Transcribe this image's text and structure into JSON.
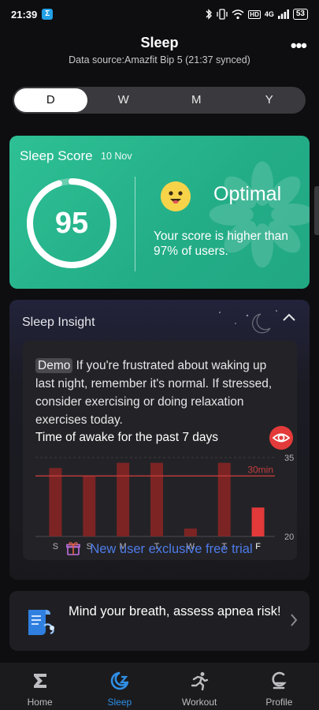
{
  "status_bar": {
    "time": "21:39",
    "app_badge": "Σ",
    "network": "4G",
    "hd": "HD",
    "battery": "53"
  },
  "header": {
    "title": "Sleep",
    "subtitle": "Data source:Amazfit Bip 5 (21:37 synced)",
    "more": "•••"
  },
  "period_tabs": [
    {
      "label": "D",
      "active": true
    },
    {
      "label": "W",
      "active": false
    },
    {
      "label": "M",
      "active": false
    },
    {
      "label": "Y",
      "active": false
    }
  ],
  "score_card": {
    "title": "Sleep Score",
    "date": "10 Nov",
    "score": "95",
    "score_fraction": 0.95,
    "status": "Optimal",
    "description": "Your score is higher than 97% of users.",
    "color": "#2bbb91"
  },
  "insight": {
    "title": "Sleep Insight",
    "demo_label": "Demo",
    "text": "If you're frustrated about waking up last night, remember it's normal. If stressed, consider exercising or doing relaxation exercises today.",
    "chart_title": "Time of awake for the past 7 days",
    "trial_text": "New user exclusive free trial"
  },
  "chart_data": {
    "type": "bar",
    "categories": [
      "S",
      "S",
      "M",
      "T",
      "W",
      "T",
      "F"
    ],
    "values": [
      33,
      31.5,
      34,
      34,
      21.5,
      34,
      25.5
    ],
    "highlight_index": 6,
    "reference_line": {
      "value": 31.5,
      "label": "30min"
    },
    "y_ticks": [
      "35",
      "20"
    ],
    "ylim": [
      20,
      35
    ],
    "colors": {
      "bar": "#7c2424",
      "highlight": "#e23a3a",
      "line": "#c43c3c"
    }
  },
  "apnea_card": {
    "text": "Mind your breath, assess apnea risk!",
    "chevron": "›"
  },
  "bottom_nav": [
    {
      "label": "Home",
      "icon": "sigma-icon",
      "active": false
    },
    {
      "label": "Sleep",
      "icon": "sleep-moon-icon",
      "active": true
    },
    {
      "label": "Workout",
      "icon": "runner-icon",
      "active": false
    },
    {
      "label": "Profile",
      "icon": "profile-icon",
      "active": false
    }
  ]
}
